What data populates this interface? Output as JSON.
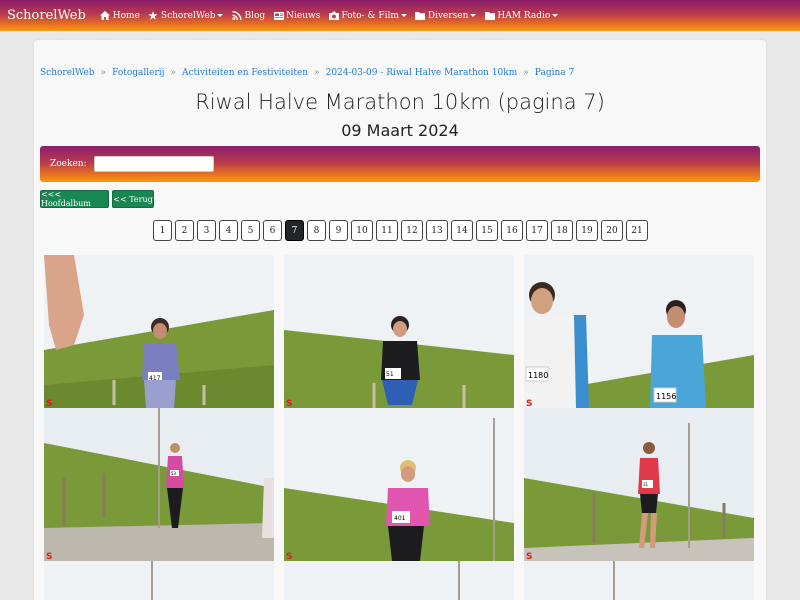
{
  "navbar": {
    "brand": "SchorelWeb",
    "items": [
      {
        "label": "Home",
        "icon": "home-icon",
        "dropdown": false
      },
      {
        "label": "SchorelWeb",
        "icon": "star-icon",
        "dropdown": true
      },
      {
        "label": "Blog",
        "icon": "rss-icon",
        "dropdown": false
      },
      {
        "label": "Nieuws",
        "icon": "newspaper-icon",
        "dropdown": false
      },
      {
        "label": "Foto- & Film",
        "icon": "camera-icon",
        "dropdown": true
      },
      {
        "label": "Diversen",
        "icon": "folder-icon",
        "dropdown": true
      },
      {
        "label": "HAM Radio",
        "icon": "folder-icon",
        "dropdown": true
      }
    ]
  },
  "breadcrumb": [
    "SchorelWeb",
    "Fotogallerij",
    "Activiteiten en Festiviteiten",
    "2024-03-09 - Riwal Halve Marathon 10km",
    "Pagina 7"
  ],
  "page": {
    "title": "Riwal Halve Marathon 10km (pagina 7)",
    "subtitle": "09 Maart 2024"
  },
  "search": {
    "label": "Zoeken:",
    "value": ""
  },
  "buttons": {
    "main_album": "<<< Hoofdalbum",
    "back": "<< Terug"
  },
  "pagination": {
    "pages": [
      "1",
      "2",
      "3",
      "4",
      "5",
      "6",
      "7",
      "8",
      "9",
      "10",
      "11",
      "12",
      "13",
      "14",
      "15",
      "16",
      "17",
      "18",
      "19",
      "20",
      "21"
    ],
    "active": "7"
  },
  "photos": [
    {
      "bib": "417"
    },
    {
      "bib": "51"
    },
    {
      "bib": "1180",
      "bib2": "1156"
    },
    {
      "bib": "53"
    },
    {
      "bib": "401"
    },
    {
      "bib": "31"
    }
  ],
  "colors": {
    "accent_gradient_start": "#8b1d6d",
    "accent_gradient_end": "#f79a10",
    "button_green": "#198754",
    "link_blue": "#1f7bd8"
  }
}
